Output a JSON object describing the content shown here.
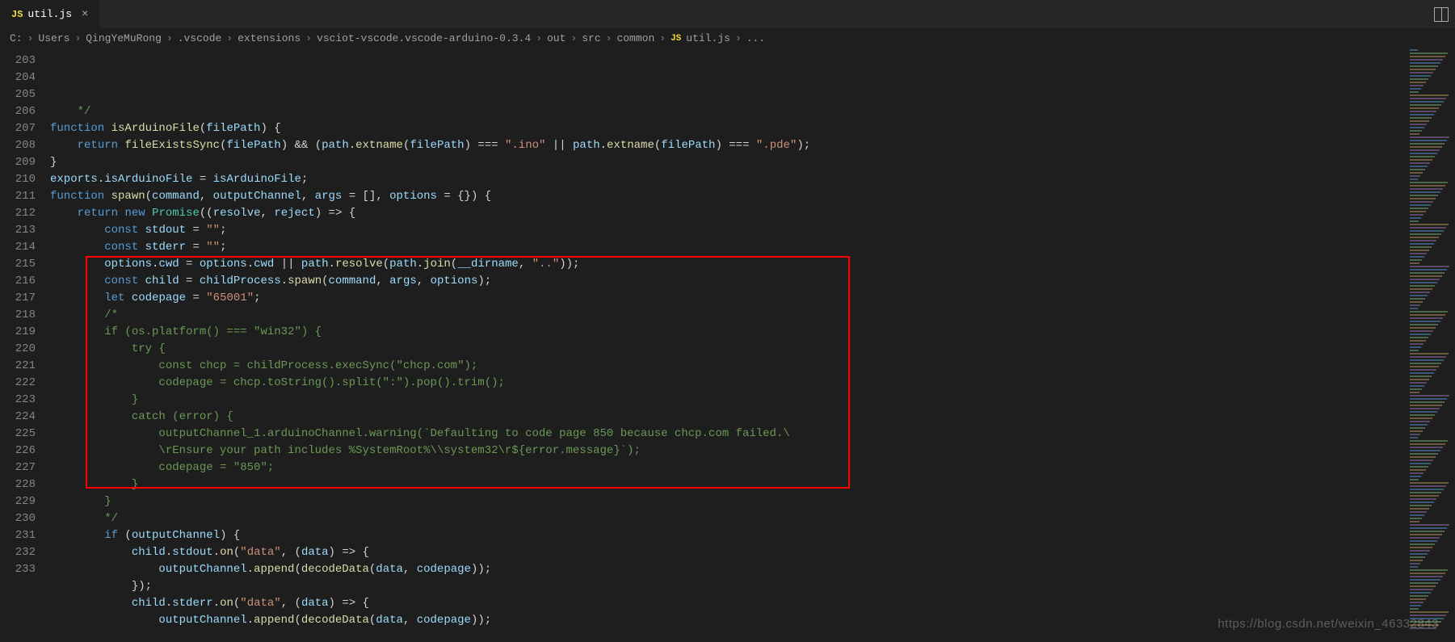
{
  "tab": {
    "icon_label": "JS",
    "filename": "util.js"
  },
  "breadcrumbs": {
    "segments": [
      "C:",
      "Users",
      "QingYeMuRong",
      ".vscode",
      "extensions",
      "vsciot-vscode.vscode-arduino-0.3.4",
      "out",
      "src",
      "common"
    ],
    "file_icon": "JS",
    "file": "util.js",
    "trail": "..."
  },
  "line_start": 203,
  "line_end": 233,
  "highlight_box": {
    "from_line": 215,
    "to_line": 228
  },
  "code": [
    {
      "type": "cm",
      "indent": 1,
      "text": "*/"
    },
    {
      "type": "raw",
      "indent": 0,
      "tokens": [
        [
          "kw",
          "function"
        ],
        [
          "op",
          " "
        ],
        [
          "fn",
          "isArduinoFile"
        ],
        [
          "op",
          "("
        ],
        [
          "var",
          "filePath"
        ],
        [
          "op",
          ") {"
        ]
      ]
    },
    {
      "type": "raw",
      "indent": 1,
      "tokens": [
        [
          "kw",
          "return"
        ],
        [
          "op",
          " "
        ],
        [
          "fn",
          "fileExistsSync"
        ],
        [
          "op",
          "("
        ],
        [
          "var",
          "filePath"
        ],
        [
          "op",
          ") && ("
        ],
        [
          "var",
          "path"
        ],
        [
          "op",
          "."
        ],
        [
          "fn",
          "extname"
        ],
        [
          "op",
          "("
        ],
        [
          "var",
          "filePath"
        ],
        [
          "op",
          ") === "
        ],
        [
          "str",
          "\".ino\""
        ],
        [
          "op",
          " || "
        ],
        [
          "var",
          "path"
        ],
        [
          "op",
          "."
        ],
        [
          "fn",
          "extname"
        ],
        [
          "op",
          "("
        ],
        [
          "var",
          "filePath"
        ],
        [
          "op",
          ") === "
        ],
        [
          "str",
          "\".pde\""
        ],
        [
          "op",
          ");"
        ]
      ]
    },
    {
      "type": "raw",
      "indent": 0,
      "tokens": [
        [
          "op",
          "}"
        ]
      ]
    },
    {
      "type": "raw",
      "indent": 0,
      "tokens": [
        [
          "var",
          "exports"
        ],
        [
          "op",
          "."
        ],
        [
          "var",
          "isArduinoFile"
        ],
        [
          "op",
          " = "
        ],
        [
          "var",
          "isArduinoFile"
        ],
        [
          "op",
          ";"
        ]
      ]
    },
    {
      "type": "raw",
      "indent": 0,
      "tokens": [
        [
          "kw",
          "function"
        ],
        [
          "op",
          " "
        ],
        [
          "fn",
          "spawn"
        ],
        [
          "op",
          "("
        ],
        [
          "var",
          "command"
        ],
        [
          "op",
          ", "
        ],
        [
          "var",
          "outputChannel"
        ],
        [
          "op",
          ", "
        ],
        [
          "var",
          "args"
        ],
        [
          "op",
          " = [], "
        ],
        [
          "var",
          "options"
        ],
        [
          "op",
          " = {}) {"
        ]
      ]
    },
    {
      "type": "raw",
      "indent": 1,
      "tokens": [
        [
          "kw",
          "return"
        ],
        [
          "op",
          " "
        ],
        [
          "kw",
          "new"
        ],
        [
          "op",
          " "
        ],
        [
          "obj",
          "Promise"
        ],
        [
          "op",
          "(("
        ],
        [
          "var",
          "resolve"
        ],
        [
          "op",
          ", "
        ],
        [
          "var",
          "reject"
        ],
        [
          "op",
          ") => {"
        ]
      ]
    },
    {
      "type": "raw",
      "indent": 2,
      "tokens": [
        [
          "kw",
          "const"
        ],
        [
          "op",
          " "
        ],
        [
          "var",
          "stdout"
        ],
        [
          "op",
          " = "
        ],
        [
          "str",
          "\"\""
        ],
        [
          "op",
          ";"
        ]
      ]
    },
    {
      "type": "raw",
      "indent": 2,
      "tokens": [
        [
          "kw",
          "const"
        ],
        [
          "op",
          " "
        ],
        [
          "var",
          "stderr"
        ],
        [
          "op",
          " = "
        ],
        [
          "str",
          "\"\""
        ],
        [
          "op",
          ";"
        ]
      ]
    },
    {
      "type": "raw",
      "indent": 2,
      "tokens": [
        [
          "var",
          "options"
        ],
        [
          "op",
          "."
        ],
        [
          "var",
          "cwd"
        ],
        [
          "op",
          " = "
        ],
        [
          "var",
          "options"
        ],
        [
          "op",
          "."
        ],
        [
          "var",
          "cwd"
        ],
        [
          "op",
          " || "
        ],
        [
          "var",
          "path"
        ],
        [
          "op",
          "."
        ],
        [
          "fn",
          "resolve"
        ],
        [
          "op",
          "("
        ],
        [
          "var",
          "path"
        ],
        [
          "op",
          "."
        ],
        [
          "fn",
          "join"
        ],
        [
          "op",
          "("
        ],
        [
          "var",
          "__dirname"
        ],
        [
          "op",
          ", "
        ],
        [
          "str",
          "\"..\""
        ],
        [
          "op",
          "));"
        ]
      ]
    },
    {
      "type": "raw",
      "indent": 2,
      "tokens": [
        [
          "kw",
          "const"
        ],
        [
          "op",
          " "
        ],
        [
          "var",
          "child"
        ],
        [
          "op",
          " = "
        ],
        [
          "var",
          "childProcess"
        ],
        [
          "op",
          "."
        ],
        [
          "fn",
          "spawn"
        ],
        [
          "op",
          "("
        ],
        [
          "var",
          "command"
        ],
        [
          "op",
          ", "
        ],
        [
          "var",
          "args"
        ],
        [
          "op",
          ", "
        ],
        [
          "var",
          "options"
        ],
        [
          "op",
          ");"
        ]
      ]
    },
    {
      "type": "raw",
      "indent": 2,
      "tokens": [
        [
          "kw",
          "let"
        ],
        [
          "op",
          " "
        ],
        [
          "var",
          "codepage"
        ],
        [
          "op",
          " = "
        ],
        [
          "str",
          "\"65001\""
        ],
        [
          "op",
          ";"
        ]
      ]
    },
    {
      "type": "cm",
      "indent": 2,
      "text": "/*"
    },
    {
      "type": "cm",
      "indent": 2,
      "text": "if (os.platform() === \"win32\") {"
    },
    {
      "type": "cm",
      "indent": 3,
      "text": "try {"
    },
    {
      "type": "cm",
      "indent": 4,
      "text": "const chcp = childProcess.execSync(\"chcp.com\");"
    },
    {
      "type": "cm",
      "indent": 4,
      "text": "codepage = chcp.toString().split(\":\").pop().trim();"
    },
    {
      "type": "cm",
      "indent": 3,
      "text": "}"
    },
    {
      "type": "cm",
      "indent": 3,
      "text": "catch (error) {"
    },
    {
      "type": "cm",
      "indent": 4,
      "text": "outputChannel_1.arduinoChannel.warning(`Defaulting to code page 850 because chcp.com failed.\\"
    },
    {
      "type": "cm",
      "indent": 4,
      "text": "\\rEnsure your path includes %SystemRoot%\\\\system32\\r${error.message}`);"
    },
    {
      "type": "cm",
      "indent": 4,
      "text": "codepage = \"850\";"
    },
    {
      "type": "cm",
      "indent": 3,
      "text": "}"
    },
    {
      "type": "cm",
      "indent": 2,
      "text": "}"
    },
    {
      "type": "cm",
      "indent": 2,
      "text": "*/"
    },
    {
      "type": "raw",
      "indent": 2,
      "tokens": [
        [
          "kw",
          "if"
        ],
        [
          "op",
          " ("
        ],
        [
          "var",
          "outputChannel"
        ],
        [
          "op",
          ") {"
        ]
      ]
    },
    {
      "type": "raw",
      "indent": 3,
      "tokens": [
        [
          "var",
          "child"
        ],
        [
          "op",
          "."
        ],
        [
          "var",
          "stdout"
        ],
        [
          "op",
          "."
        ],
        [
          "fn",
          "on"
        ],
        [
          "op",
          "("
        ],
        [
          "str",
          "\"data\""
        ],
        [
          "op",
          ", ("
        ],
        [
          "var",
          "data"
        ],
        [
          "op",
          ") => {"
        ]
      ]
    },
    {
      "type": "raw",
      "indent": 4,
      "tokens": [
        [
          "var",
          "outputChannel"
        ],
        [
          "op",
          "."
        ],
        [
          "fn",
          "append"
        ],
        [
          "op",
          "("
        ],
        [
          "fn",
          "decodeData"
        ],
        [
          "op",
          "("
        ],
        [
          "var",
          "data"
        ],
        [
          "op",
          ", "
        ],
        [
          "var",
          "codepage"
        ],
        [
          "op",
          "));"
        ]
      ]
    },
    {
      "type": "raw",
      "indent": 3,
      "tokens": [
        [
          "op",
          "});"
        ]
      ]
    },
    {
      "type": "raw",
      "indent": 3,
      "tokens": [
        [
          "var",
          "child"
        ],
        [
          "op",
          "."
        ],
        [
          "var",
          "stderr"
        ],
        [
          "op",
          "."
        ],
        [
          "fn",
          "on"
        ],
        [
          "op",
          "("
        ],
        [
          "str",
          "\"data\""
        ],
        [
          "op",
          ", ("
        ],
        [
          "var",
          "data"
        ],
        [
          "op",
          ") => {"
        ]
      ]
    },
    {
      "type": "raw",
      "indent": 4,
      "tokens": [
        [
          "var",
          "outputChannel"
        ],
        [
          "op",
          "."
        ],
        [
          "fn",
          "append"
        ],
        [
          "op",
          "("
        ],
        [
          "fn",
          "decodeData"
        ],
        [
          "op",
          "("
        ],
        [
          "var",
          "data"
        ],
        [
          "op",
          ", "
        ],
        [
          "var",
          "codepage"
        ],
        [
          "op",
          "));"
        ]
      ]
    }
  ],
  "watermark": "https://blog.csdn.net/weixin_46332843"
}
